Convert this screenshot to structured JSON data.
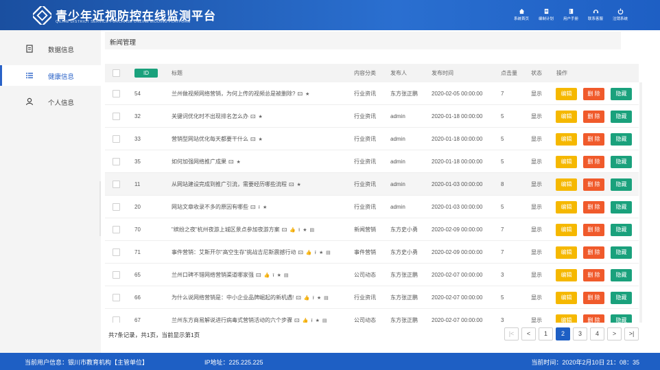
{
  "header": {
    "title": "青少年近视防控在线监测平台",
    "subtitle": "QILIHE DISTRICT SERVICE PURCHASE ONLINE BIDDING PLATFORM",
    "nav": [
      {
        "label": "系统首页",
        "icon": "home-icon"
      },
      {
        "label": "编制计划",
        "icon": "plan-icon"
      },
      {
        "label": "用户手册",
        "icon": "manual-icon"
      },
      {
        "label": "联系客服",
        "icon": "support-icon"
      },
      {
        "label": "注销系统",
        "icon": "power-icon"
      }
    ]
  },
  "sidebar": {
    "items": [
      {
        "label": "数据信息",
        "icon": "document-icon"
      },
      {
        "label": "健康信息",
        "icon": "list-icon"
      },
      {
        "label": "个人信息",
        "icon": "user-icon"
      }
    ],
    "active_index": 1
  },
  "page": {
    "tab_title": "新闻管理"
  },
  "table": {
    "columns": {
      "id": "ID",
      "title": "标题",
      "category": "内容分类",
      "publisher": "发布人",
      "time": "发布时间",
      "clicks": "点击量",
      "status": "状态",
      "actions": "操作"
    },
    "rows": [
      {
        "id": "54",
        "title": "兰州做视频网络营销，为何上传的视频总是被删除?",
        "marks": "🖾 ★",
        "category": "行业资讯",
        "publisher": "东方张正鹏",
        "time": "2020-02-05 00:00:00",
        "clicks": "7",
        "status": "显示"
      },
      {
        "id": "32",
        "title": "关键词优化时不出现排名怎么办",
        "marks": "🖾 ★",
        "category": "行业资讯",
        "publisher": "admin",
        "time": "2020-01-18 00:00:00",
        "clicks": "5",
        "status": "显示"
      },
      {
        "id": "33",
        "title": "营销型网站优化每天都要干什么",
        "marks": "🖾 ★",
        "category": "行业资讯",
        "publisher": "admin",
        "time": "2020-01-18 00:00:00",
        "clicks": "5",
        "status": "显示"
      },
      {
        "id": "35",
        "title": "如何加强网络推广成果",
        "marks": "🖾 ★",
        "category": "行业资讯",
        "publisher": "admin",
        "time": "2020-01-18 00:00:00",
        "clicks": "5",
        "status": "显示"
      },
      {
        "id": "11",
        "title": "从网站建设完成到推广引流，需要经历哪些流程",
        "marks": "🖾 ★",
        "category": "行业资讯",
        "publisher": "admin",
        "time": "2020-01-03 00:00:00",
        "clicks": "8",
        "status": "显示"
      },
      {
        "id": "20",
        "title": "网站文章收录不多的原因有哪些",
        "marks": "🖾 ⭱ ★",
        "category": "行业资讯",
        "publisher": "admin",
        "time": "2020-01-03 00:00:00",
        "clicks": "5",
        "status": "显示"
      },
      {
        "id": "70",
        "title": "\"缤纷之夜\"杭州夜游上城区景点参加夜游方案",
        "marks": "🖾 👍 ⭱ ★ ▤",
        "category": "新闻营销",
        "publisher": "东方史小勇",
        "time": "2020-02-09 00:00:00",
        "clicks": "7",
        "status": "显示"
      },
      {
        "id": "71",
        "title": "事件营销：艾斯开尔“高空生存”挑战吉尼斯震撼行动",
        "marks": "🖾 👍 ⭱ ★ ▤",
        "category": "事件营销",
        "publisher": "东方史小勇",
        "time": "2020-02-09 00:00:00",
        "clicks": "7",
        "status": "显示"
      },
      {
        "id": "65",
        "title": "兰州口碑不错网络营销渠道哪家强",
        "marks": "🖾 👍 ⭱ ★ ▤",
        "category": "公司动态",
        "publisher": "东方张正鹏",
        "time": "2020-02-07 00:00:00",
        "clicks": "3",
        "status": "显示"
      },
      {
        "id": "66",
        "title": "为什么说网络营销是：中小企业品牌崛起的新机遇!",
        "marks": "🖾 👍 ⭱ ★ ▤",
        "category": "行业资讯",
        "publisher": "东方张正鹏",
        "time": "2020-02-07 00:00:00",
        "clicks": "5",
        "status": "显示"
      },
      {
        "id": "67",
        "title": "兰州东方商易解说进行病毒式营销活动的六个步骤",
        "marks": "🖾 👍 ⭱ ★ ▤",
        "category": "公司动态",
        "publisher": "东方张正鹏",
        "time": "2020-02-07 00:00:00",
        "clicks": "3",
        "status": "显示"
      }
    ],
    "actions": {
      "edit": "编辑",
      "delete": "删 除",
      "hide": "隐藏"
    },
    "highlight_index": 4
  },
  "pagination": {
    "summary": "共7条记录，共1页，当前显示第1页",
    "first": "|<",
    "prev": "<",
    "next": ">",
    "last": ">|",
    "pages": [
      "1",
      "2",
      "3",
      "4"
    ],
    "current": "2"
  },
  "statusbar": {
    "user": "当前用户信息：银川市教育机构【主管单位】",
    "ip": "IP地址：225.225.225",
    "time": "当前时间：2020年2月10日 21：08：35"
  },
  "colors": {
    "primary": "#1e5fc4",
    "edit": "#f5b800",
    "delete": "#f05a2b",
    "hide": "#1aa17c"
  }
}
